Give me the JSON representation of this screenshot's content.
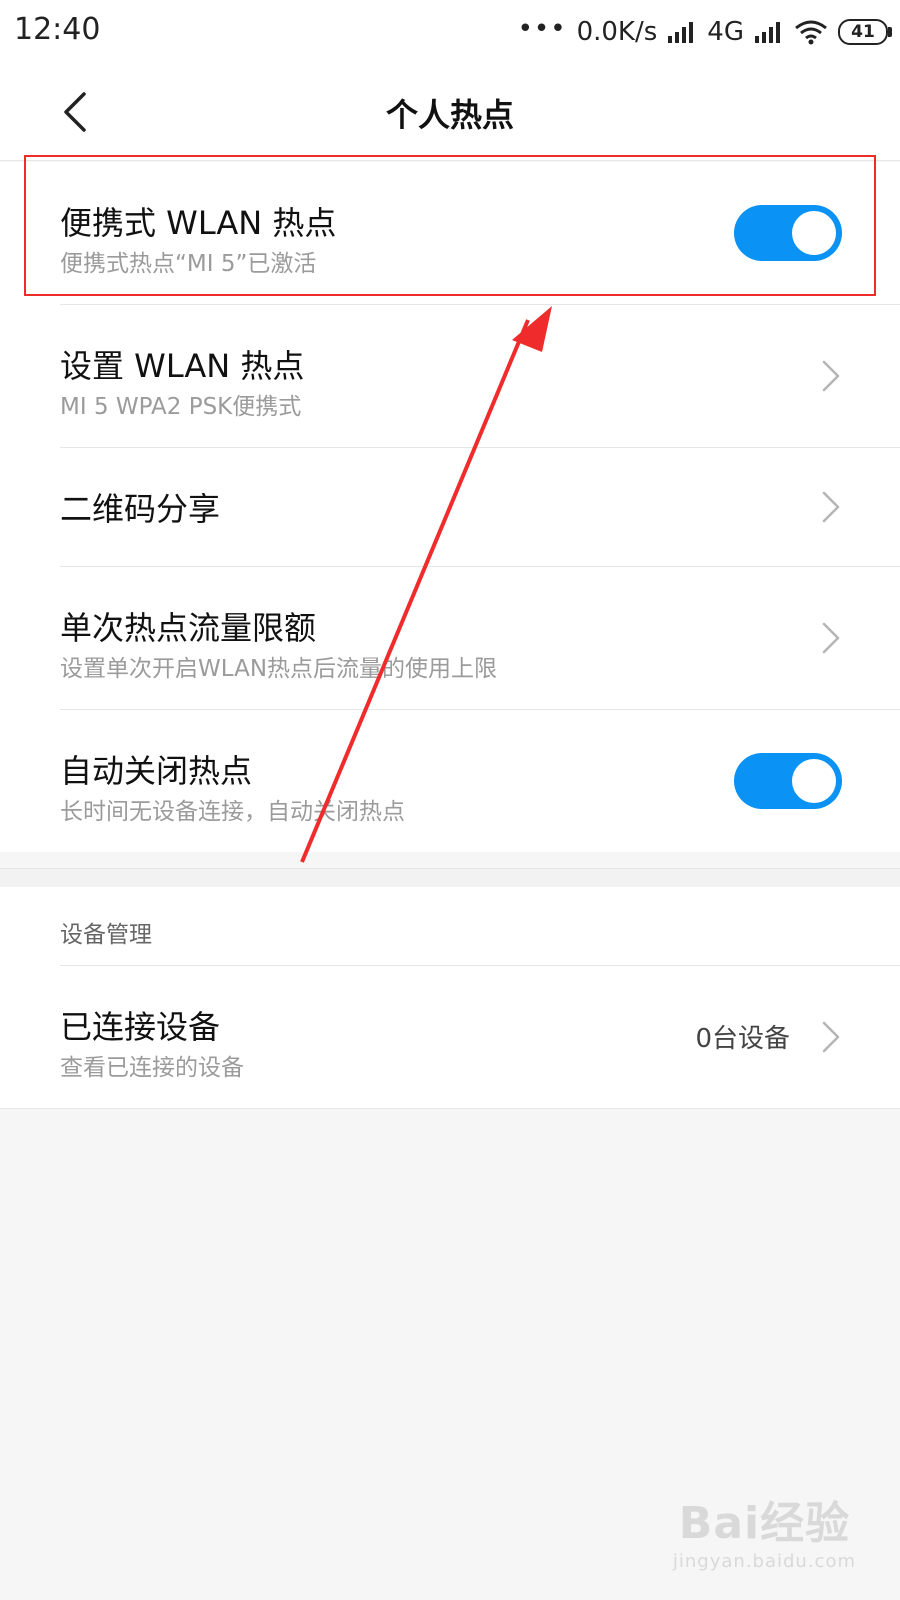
{
  "status_bar": {
    "time": "12:40",
    "network_speed": "0.0K/s",
    "network_type": "4G",
    "battery": "41"
  },
  "header": {
    "title": "个人热点"
  },
  "settings": [
    {
      "title": "便携式 WLAN 热点",
      "subtitle": "便携式热点“MI 5”已激活",
      "control": "toggle",
      "enabled": true
    },
    {
      "title": "设置 WLAN 热点",
      "subtitle": "MI 5 WPA2 PSK便携式",
      "control": "chevron"
    },
    {
      "title": "二维码分享",
      "subtitle": "",
      "control": "chevron"
    },
    {
      "title": "单次热点流量限额",
      "subtitle": "设置单次开启WLAN热点后流量的使用上限",
      "control": "chevron"
    },
    {
      "title": "自动关闭热点",
      "subtitle": "长时间无设备连接，自动关闭热点",
      "control": "toggle",
      "enabled": true
    }
  ],
  "device_management": {
    "section_title": "设备管理",
    "connected": {
      "title": "已连接设备",
      "subtitle": "查看已连接的设备",
      "value": "0台设备"
    }
  },
  "watermark": {
    "logo": "Bai经验",
    "url": "jingyan.baidu.com"
  },
  "colors": {
    "toggle_on": "#0a92f5",
    "annotation_red": "#ef2b2b"
  },
  "icons": {
    "back": "chevron-left-icon",
    "row_arrow": "chevron-right-icon",
    "signal": "signal-icon",
    "wifi": "wifi-icon",
    "battery": "battery-icon"
  }
}
